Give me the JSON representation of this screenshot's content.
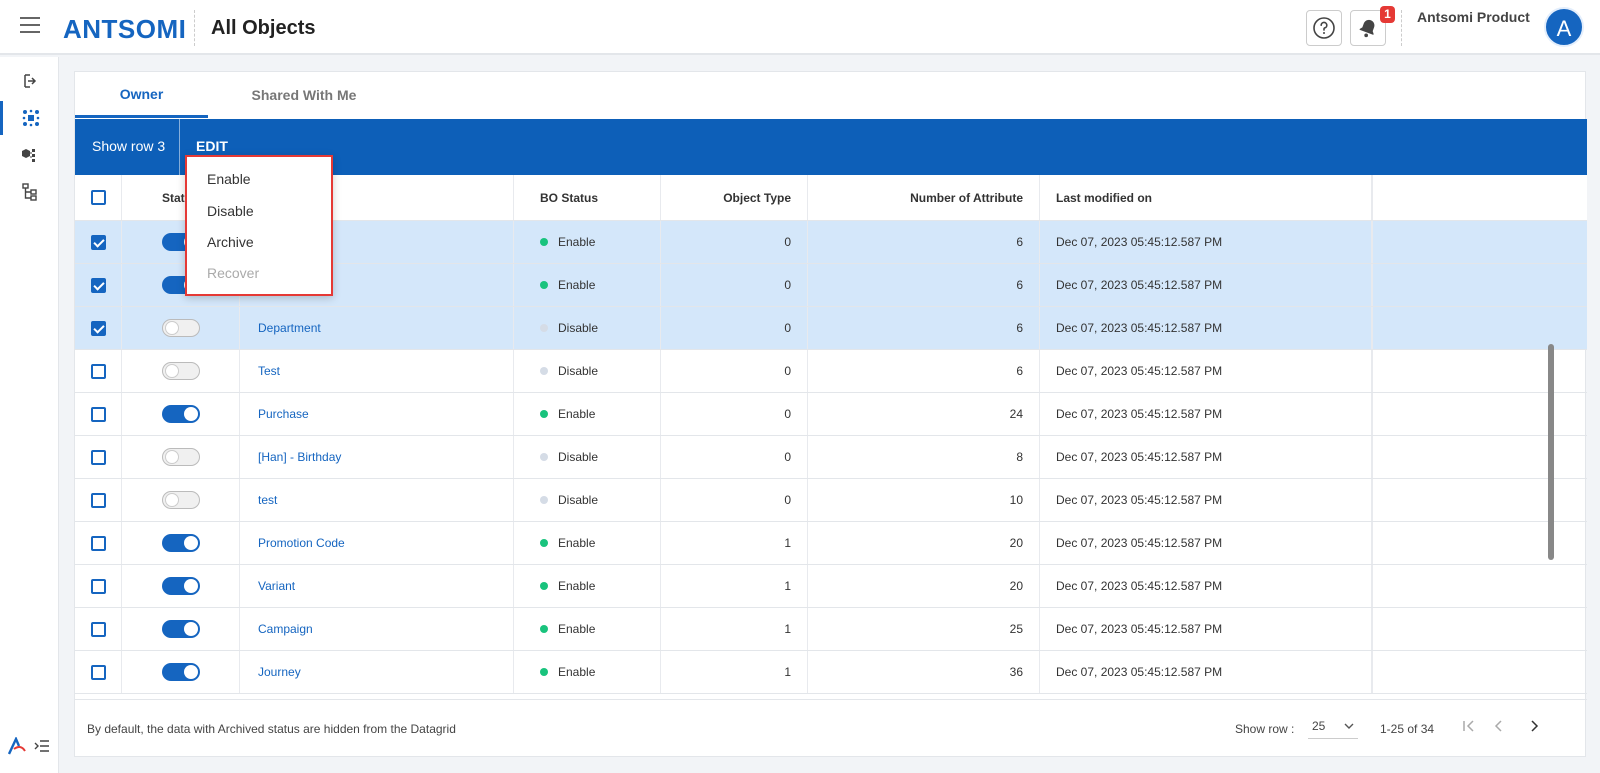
{
  "header": {
    "logo": "ANTSOMI",
    "title": "All Objects",
    "notification_count": "1",
    "user_name": "Antsomi Product",
    "avatar_initial": "A"
  },
  "tabs": [
    {
      "label": "Owner",
      "active": true
    },
    {
      "label": "Shared With Me",
      "active": false
    }
  ],
  "toolbar": {
    "selection_label": "Show row 3",
    "edit_label": "EDIT"
  },
  "menu": {
    "items": [
      {
        "label": "Enable",
        "disabled": false
      },
      {
        "label": "Disable",
        "disabled": false
      },
      {
        "label": "Archive",
        "disabled": false
      },
      {
        "label": "Recover",
        "disabled": true
      }
    ]
  },
  "grid": {
    "columns": {
      "status": "Status",
      "bo_status": "BO Status",
      "object_type": "Object Type",
      "num_attr": "Number of Attribute",
      "last_modified": "Last modified on"
    },
    "rows": [
      {
        "checked": true,
        "toggle": true,
        "name": "",
        "bo_status": "Enable",
        "object_type": "0",
        "num_attr": "6",
        "modified": "Dec 07, 2023 05:45:12.587 PM"
      },
      {
        "checked": true,
        "toggle": true,
        "name": "",
        "bo_status": "Enable",
        "object_type": "0",
        "num_attr": "6",
        "modified": "Dec 07, 2023 05:45:12.587 PM"
      },
      {
        "checked": true,
        "toggle": false,
        "name": "Department",
        "bo_status": "Disable",
        "object_type": "0",
        "num_attr": "6",
        "modified": "Dec 07, 2023 05:45:12.587 PM"
      },
      {
        "checked": false,
        "toggle": false,
        "name": "Test",
        "bo_status": "Disable",
        "object_type": "0",
        "num_attr": "6",
        "modified": "Dec 07, 2023 05:45:12.587 PM"
      },
      {
        "checked": false,
        "toggle": true,
        "name": "Purchase",
        "bo_status": "Enable",
        "object_type": "0",
        "num_attr": "24",
        "modified": "Dec 07, 2023 05:45:12.587 PM"
      },
      {
        "checked": false,
        "toggle": false,
        "name": "[Han] - Birthday",
        "bo_status": "Disable",
        "object_type": "0",
        "num_attr": "8",
        "modified": "Dec 07, 2023 05:45:12.587 PM"
      },
      {
        "checked": false,
        "toggle": false,
        "name": "test",
        "bo_status": "Disable",
        "object_type": "0",
        "num_attr": "10",
        "modified": "Dec 07, 2023 05:45:12.587 PM"
      },
      {
        "checked": false,
        "toggle": true,
        "name": "Promotion Code",
        "bo_status": "Enable",
        "object_type": "1",
        "num_attr": "20",
        "modified": "Dec 07, 2023 05:45:12.587 PM"
      },
      {
        "checked": false,
        "toggle": true,
        "name": "Variant",
        "bo_status": "Enable",
        "object_type": "1",
        "num_attr": "20",
        "modified": "Dec 07, 2023 05:45:12.587 PM"
      },
      {
        "checked": false,
        "toggle": true,
        "name": "Campaign",
        "bo_status": "Enable",
        "object_type": "1",
        "num_attr": "25",
        "modified": "Dec 07, 2023 05:45:12.587 PM"
      },
      {
        "checked": false,
        "toggle": true,
        "name": "Journey",
        "bo_status": "Enable",
        "object_type": "1",
        "num_attr": "36",
        "modified": "Dec 07, 2023 05:45:12.587 PM"
      }
    ]
  },
  "footer": {
    "note": "By default, the data with Archived status are hidden from the Datagrid",
    "show_row_label": "Show row :",
    "page_size": "25",
    "range": "1-25 of 34"
  },
  "colors": {
    "primary": "#1565c0",
    "toolbar": "#0d5fb8",
    "enable_dot": "#19c37d",
    "disable_dot": "#d5dce6",
    "selected_row": "#d4e7fa",
    "menu_border": "#e53935"
  },
  "icons": {
    "menu": "hamburger-icon",
    "help": "help-circle-icon",
    "notifications": "bell-icon",
    "rail": [
      "import-icon",
      "objects-icon",
      "cubes-icon",
      "hierarchy-icon"
    ],
    "pagination": [
      "first-page-icon",
      "prev-page-icon",
      "next-page-icon"
    ]
  }
}
